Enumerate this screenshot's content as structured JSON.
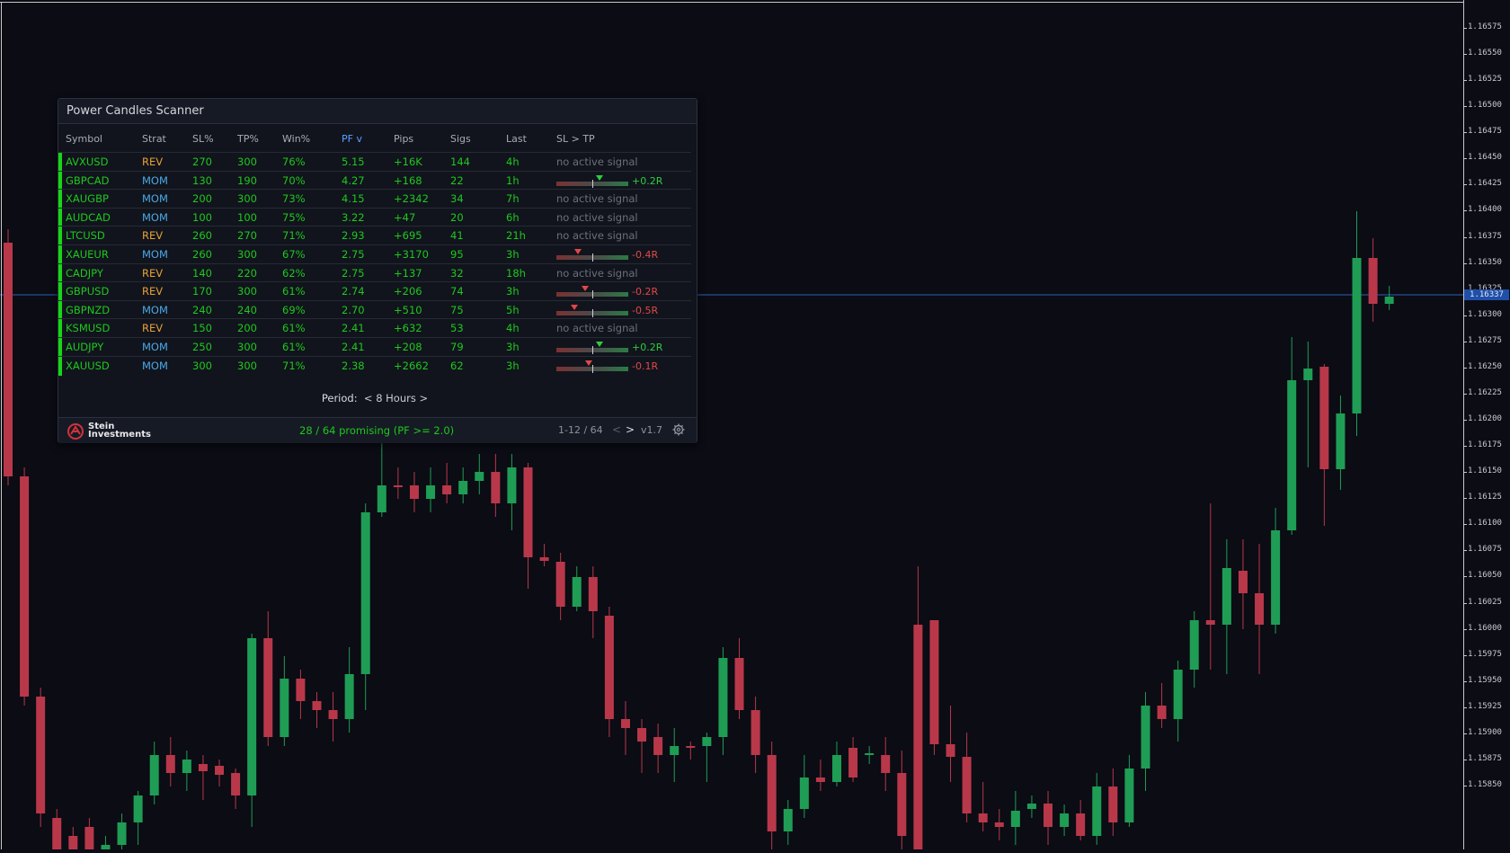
{
  "chart": {
    "price_labels": [
      "1.16575",
      "1.16550",
      "1.16525",
      "1.16500",
      "1.16475",
      "1.16450",
      "1.16425",
      "1.16400",
      "1.16375",
      "1.16350",
      "1.16325",
      "1.16300",
      "1.16275",
      "1.16250",
      "1.16225",
      "1.16200",
      "1.16175",
      "1.16150",
      "1.16125",
      "1.16100",
      "1.16075",
      "1.16050",
      "1.16025",
      "1.16000",
      "1.15975",
      "1.15950",
      "1.15925",
      "1.15900",
      "1.15875",
      "1.15850"
    ],
    "current_price": "1.16337",
    "up_color": "#1f9d55",
    "down_color": "#b8384a",
    "line_color": "#2d5fb8"
  },
  "scanner": {
    "title": "Power Candles Scanner",
    "headers": {
      "symbol": "Symbol",
      "strat": "Strat",
      "sl": "SL%",
      "tp": "TP%",
      "win": "Win%",
      "pf": "PF  v",
      "pips": "Pips",
      "sigs": "Sigs",
      "last": "Last",
      "sltp": "SL > TP"
    },
    "rows": [
      {
        "symbol": "AVXUSD",
        "strat": "REV",
        "sl": "270",
        "tp": "300",
        "win": "76%",
        "pf": "5.15",
        "pips": "+16K",
        "sigs": "144",
        "last": "4h",
        "signal": "no active signal"
      },
      {
        "symbol": "GBPCAD",
        "strat": "MOM",
        "sl": "130",
        "tp": "190",
        "win": "70%",
        "pf": "4.27",
        "pips": "+168",
        "sigs": "22",
        "last": "1h",
        "risk": 0.2,
        "risk_label": "+0.2R"
      },
      {
        "symbol": "XAUGBP",
        "strat": "MOM",
        "sl": "200",
        "tp": "300",
        "win": "73%",
        "pf": "4.15",
        "pips": "+2342",
        "sigs": "34",
        "last": "7h",
        "signal": "no active signal"
      },
      {
        "symbol": "AUDCAD",
        "strat": "MOM",
        "sl": "100",
        "tp": "100",
        "win": "75%",
        "pf": "3.22",
        "pips": "+47",
        "sigs": "20",
        "last": "6h",
        "signal": "no active signal"
      },
      {
        "symbol": "LTCUSD",
        "strat": "REV",
        "sl": "260",
        "tp": "270",
        "win": "71%",
        "pf": "2.93",
        "pips": "+695",
        "sigs": "41",
        "last": "21h",
        "signal": "no active signal"
      },
      {
        "symbol": "XAUEUR",
        "strat": "MOM",
        "sl": "260",
        "tp": "300",
        "win": "67%",
        "pf": "2.75",
        "pips": "+3170",
        "sigs": "95",
        "last": "3h",
        "risk": -0.4,
        "risk_label": "-0.4R"
      },
      {
        "symbol": "CADJPY",
        "strat": "REV",
        "sl": "140",
        "tp": "220",
        "win": "62%",
        "pf": "2.75",
        "pips": "+137",
        "sigs": "32",
        "last": "18h",
        "signal": "no active signal"
      },
      {
        "symbol": "GBPUSD",
        "strat": "REV",
        "sl": "170",
        "tp": "300",
        "win": "61%",
        "pf": "2.74",
        "pips": "+206",
        "sigs": "74",
        "last": "3h",
        "risk": -0.2,
        "risk_label": "-0.2R"
      },
      {
        "symbol": "GBPNZD",
        "strat": "MOM",
        "sl": "240",
        "tp": "240",
        "win": "69%",
        "pf": "2.70",
        "pips": "+510",
        "sigs": "75",
        "last": "5h",
        "risk": -0.5,
        "risk_label": "-0.5R"
      },
      {
        "symbol": "KSMUSD",
        "strat": "REV",
        "sl": "150",
        "tp": "200",
        "win": "61%",
        "pf": "2.41",
        "pips": "+632",
        "sigs": "53",
        "last": "4h",
        "signal": "no active signal"
      },
      {
        "symbol": "AUDJPY",
        "strat": "MOM",
        "sl": "250",
        "tp": "300",
        "win": "61%",
        "pf": "2.41",
        "pips": "+208",
        "sigs": "79",
        "last": "3h",
        "risk": 0.2,
        "risk_label": "+0.2R"
      },
      {
        "symbol": "XAUUSD",
        "strat": "MOM",
        "sl": "300",
        "tp": "300",
        "win": "71%",
        "pf": "2.38",
        "pips": "+2662",
        "sigs": "62",
        "last": "3h",
        "risk": -0.1,
        "risk_label": "-0.1R"
      }
    ],
    "period_label": "Period:",
    "period_value": "8 Hours",
    "period_prev": "<",
    "period_next": ">",
    "logo_line1": "Stein",
    "logo_line2": "Investments",
    "promising": "28 / 64 promising (PF >= 2.0)",
    "page_info": "1-12 / 64",
    "prev_page": "<",
    "next_page": ">",
    "version": "v1.7",
    "colors": {
      "accent_green": "#1ec81e",
      "rev": "#e8a037",
      "mom": "#4aa8e8",
      "sort_active": "#5aa0ff"
    }
  }
}
